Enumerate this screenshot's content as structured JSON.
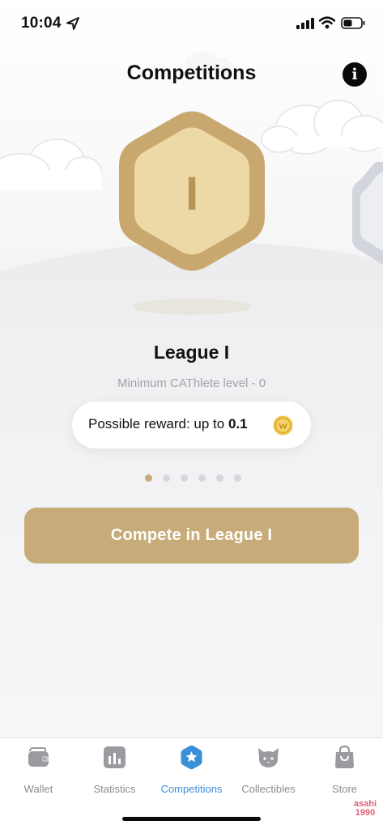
{
  "status_bar": {
    "time": "10:04"
  },
  "header": {
    "title": "Competitions",
    "info_icon_glyph": "i"
  },
  "league": {
    "badge_numeral": "I",
    "name": "League I",
    "min_level": "Minimum CAThlete level - 0",
    "reward_label": "Possible reward: up to",
    "reward_value": "0.1",
    "reward_icon": "coin-icon"
  },
  "pagination": {
    "total": 6,
    "active_index": 0
  },
  "compete_button": {
    "label": "Compete in League I"
  },
  "tabs": [
    {
      "label": "Wallet",
      "icon": "wallet-icon",
      "active": false
    },
    {
      "label": "Statistics",
      "icon": "statistics-icon",
      "active": false
    },
    {
      "label": "Competitions",
      "icon": "competitions-icon",
      "active": true
    },
    {
      "label": "Collectibles",
      "icon": "cat-icon",
      "active": false
    },
    {
      "label": "Store",
      "icon": "shopping-bag-icon",
      "active": false
    }
  ],
  "watermark": {
    "line1": "asahi",
    "line2": "1990"
  },
  "colors": {
    "accent_gold": "#c7ab78",
    "badge_outer": "#c9a86f",
    "badge_inner": "#edd9a6",
    "active_tab": "#3a8fd8",
    "inactive_tab": "#8c8c92"
  }
}
